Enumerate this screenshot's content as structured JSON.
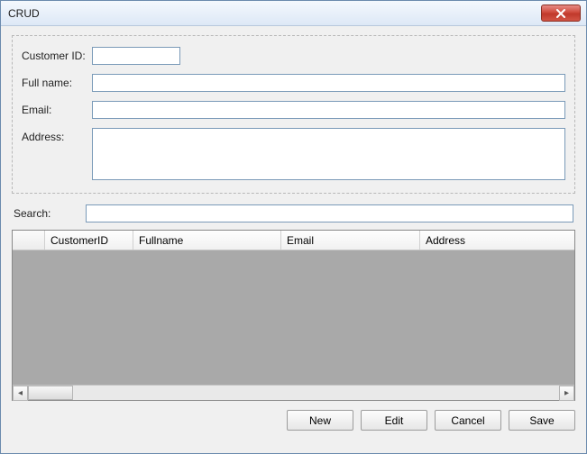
{
  "window": {
    "title": "CRUD"
  },
  "form": {
    "customer_id": {
      "label": "Customer ID:",
      "value": ""
    },
    "full_name": {
      "label": "Full name:",
      "value": ""
    },
    "email": {
      "label": "Email:",
      "value": ""
    },
    "address": {
      "label": "Address:",
      "value": ""
    }
  },
  "search": {
    "label": "Search:",
    "value": ""
  },
  "grid": {
    "columns": [
      "CustomerID",
      "Fullname",
      "Email",
      "Address"
    ],
    "rows": []
  },
  "buttons": {
    "new": "New",
    "edit": "Edit",
    "cancel": "Cancel",
    "save": "Save"
  }
}
